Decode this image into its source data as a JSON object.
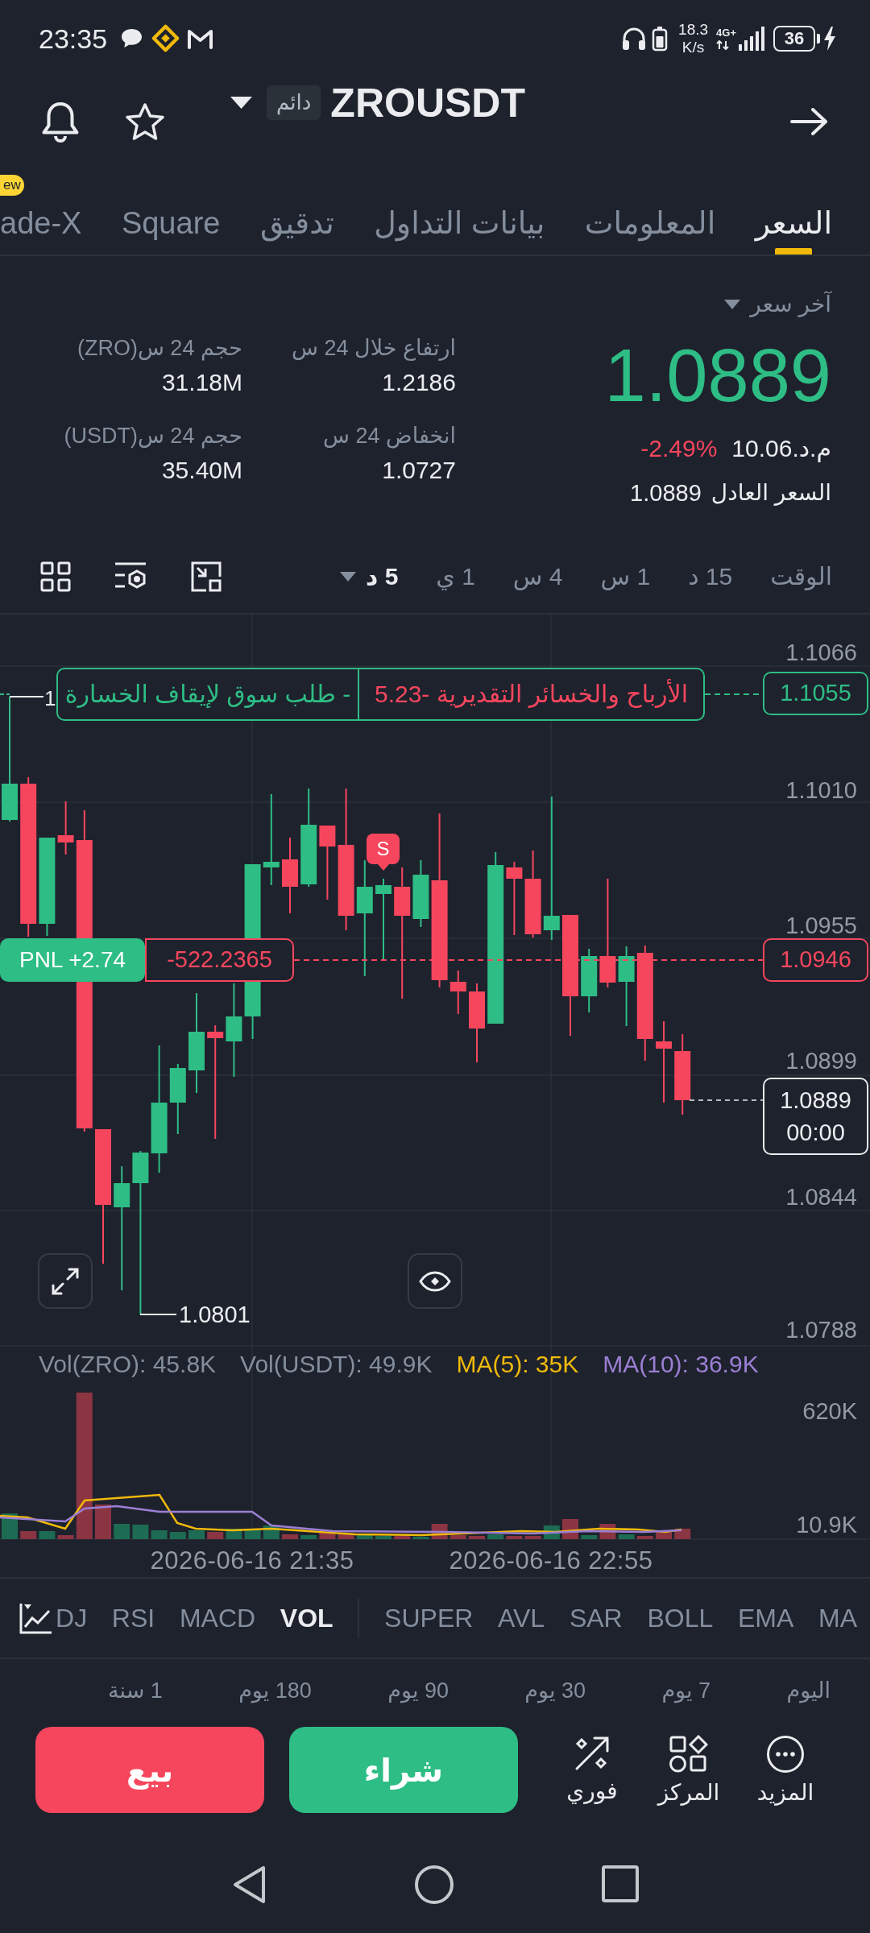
{
  "status_bar": {
    "time": "23:35",
    "speed": "18.3",
    "speed_unit": "K/s",
    "network_type": "4G+",
    "battery": "36",
    "charging": true
  },
  "header": {
    "symbol": "ZROUSDT",
    "contract_type": "دائم",
    "favorite": false
  },
  "tabs": [
    {
      "label": "السعر",
      "selected": true
    },
    {
      "label": "المعلومات",
      "selected": false
    },
    {
      "label": "بيانات التداول",
      "selected": false
    },
    {
      "label": "تدقيق",
      "selected": false
    },
    {
      "label": "Square",
      "selected": false
    },
    {
      "label": "ade-X",
      "selected": false,
      "badge": "ew"
    }
  ],
  "price": {
    "label": "آخر سعر",
    "last": "1.0889",
    "last_up": true,
    "local_value": "م.د.10.06",
    "change": "-2.49%",
    "change_up": false,
    "fair_label": "السعر العادل",
    "fair_value": "1.0889"
  },
  "stats": [
    {
      "label": "ارتفاع خلال 24 س",
      "value": "1.2186"
    },
    {
      "label": "حجم 24 س(ZRO)",
      "value": "31.18M"
    },
    {
      "label": "انخفاض 24 س",
      "value": "1.0727"
    },
    {
      "label": "حجم 24 س(USDT)",
      "value": "35.40M"
    }
  ],
  "intervals": [
    {
      "label": "الوقت",
      "selected": false
    },
    {
      "label": "15 د",
      "selected": false
    },
    {
      "label": "1 س",
      "selected": false
    },
    {
      "label": "4 س",
      "selected": false
    },
    {
      "label": "1 ي",
      "selected": false
    },
    {
      "label": "5 د",
      "selected": true,
      "dropdown": true
    }
  ],
  "chart": {
    "price_axis": [
      "1.1066",
      "1.1010",
      "1.0955",
      "1.0899",
      "1.0844",
      "1.0788"
    ],
    "high_marker": "1",
    "low_marker": "1.0801",
    "order": {
      "type_label": "- طلب سوق لإيقاف الخسارة",
      "pnl_label": "الأرباح والخسائر التقديرية -5.23",
      "price": "1.1055"
    },
    "position": {
      "pnl": "PNL +2.74",
      "size": "-522.2365",
      "price": "1.0946"
    },
    "last_price": {
      "price": "1.0889",
      "countdown": "00:00"
    },
    "trade_marker": {
      "label": "S",
      "kind": "sell"
    }
  },
  "volume": {
    "legend": [
      {
        "label": "MA(10): 36.9K",
        "color": "#9b7fd4"
      },
      {
        "label": "MA(5): 35K",
        "color": "#f0b90b"
      },
      {
        "label": "Vol(USDT): 49.9K",
        "color": "#848e9c"
      },
      {
        "label": "Vol(ZRO): 45.8K",
        "color": "#848e9c"
      }
    ],
    "axis": [
      "620K",
      "10.9K"
    ]
  },
  "time_axis": [
    "2026-06-16 22:55",
    "2026-06-16 21:35"
  ],
  "indicators": {
    "main": [
      {
        "label": "MA",
        "selected": false
      },
      {
        "label": "EMA",
        "selected": false
      },
      {
        "label": "BOLL",
        "selected": false
      },
      {
        "label": "SAR",
        "selected": false
      },
      {
        "label": "AVL",
        "selected": false
      },
      {
        "label": "SUPER",
        "selected": false
      }
    ],
    "sub": [
      {
        "label": "VOL",
        "selected": true
      },
      {
        "label": "MACD",
        "selected": false
      },
      {
        "label": "RSI",
        "selected": false
      },
      {
        "label": "DJ",
        "selected": false
      }
    ]
  },
  "periods": [
    "اليوم",
    "7 يوم",
    "30 يوم",
    "90 يوم",
    "180 يوم",
    "1 سنة"
  ],
  "bottom_bar": [
    {
      "label": "المزيد",
      "kind": "more"
    },
    {
      "label": "المركز",
      "kind": "position"
    },
    {
      "label": "فوري",
      "kind": "instant"
    },
    {
      "label": "شراء",
      "kind": "buy"
    },
    {
      "label": "بيع",
      "kind": "sell"
    }
  ]
}
